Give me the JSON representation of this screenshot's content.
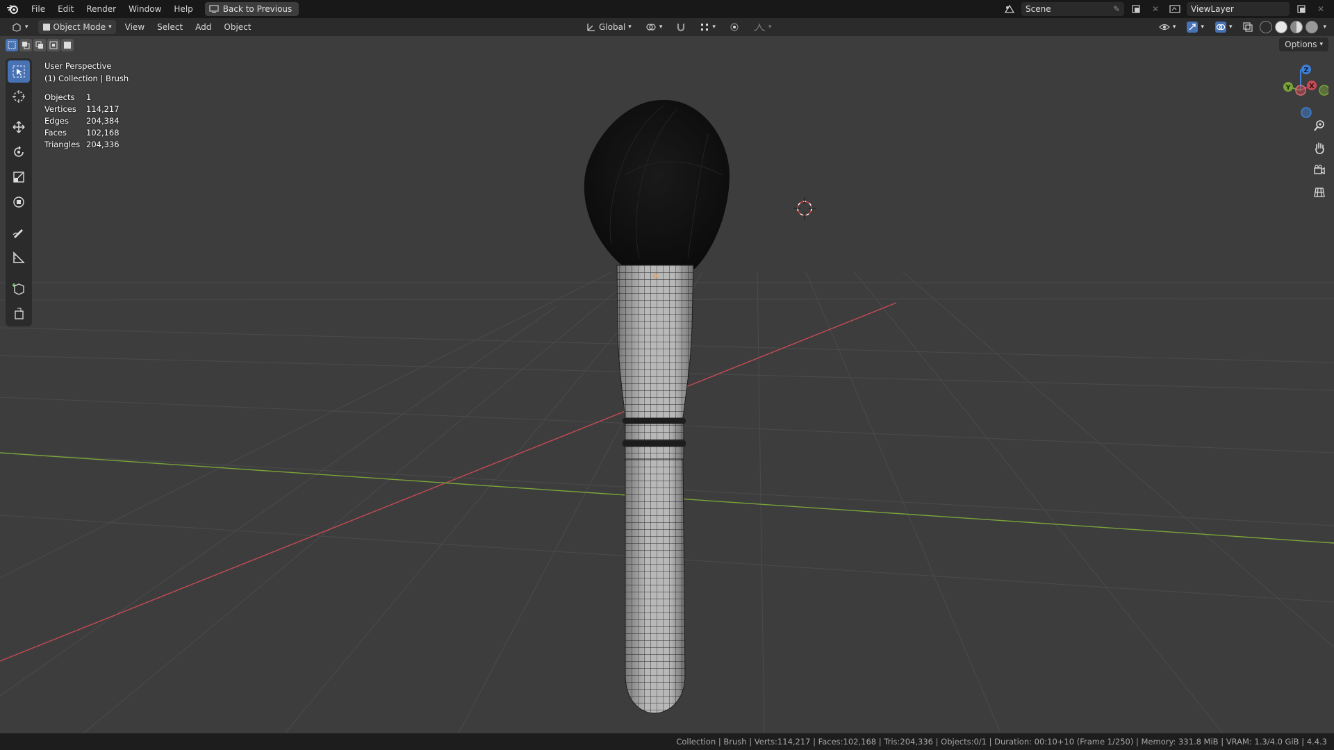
{
  "menubar": {
    "items": [
      "File",
      "Edit",
      "Render",
      "Window",
      "Help"
    ],
    "back_button": "Back to Previous",
    "scene": "Scene",
    "view_layer": "ViewLayer"
  },
  "header": {
    "mode": "Object Mode",
    "menus": [
      "View",
      "Select",
      "Add",
      "Object"
    ],
    "orientation": "Global",
    "options": "Options"
  },
  "overlay": {
    "perspective": "User Perspective",
    "collection": "(1) Collection | Brush",
    "stats": [
      {
        "label": "Objects",
        "value": "1"
      },
      {
        "label": "Vertices",
        "value": "114,217"
      },
      {
        "label": "Edges",
        "value": "204,384"
      },
      {
        "label": "Faces",
        "value": "102,168"
      },
      {
        "label": "Triangles",
        "value": "204,336"
      }
    ]
  },
  "gizmo": {
    "x": "X",
    "y": "Y",
    "z": "Z"
  },
  "statusbar": {
    "text": "Collection | Brush | Verts:114,217 | Faces:102,168 | Tris:204,336 | Objects:0/1 | Duration: 00:10+10 (Frame 1/250) | Memory: 331.8 MiB | VRAM: 1.3/4.0 GiB | 4.4.3"
  },
  "colors": {
    "viewport_bg": "#3d3d3d",
    "accent": "#4772b3",
    "x_axis": "#c84a55",
    "y_axis": "#7aa43a",
    "z_axis": "#3f7fd8"
  }
}
